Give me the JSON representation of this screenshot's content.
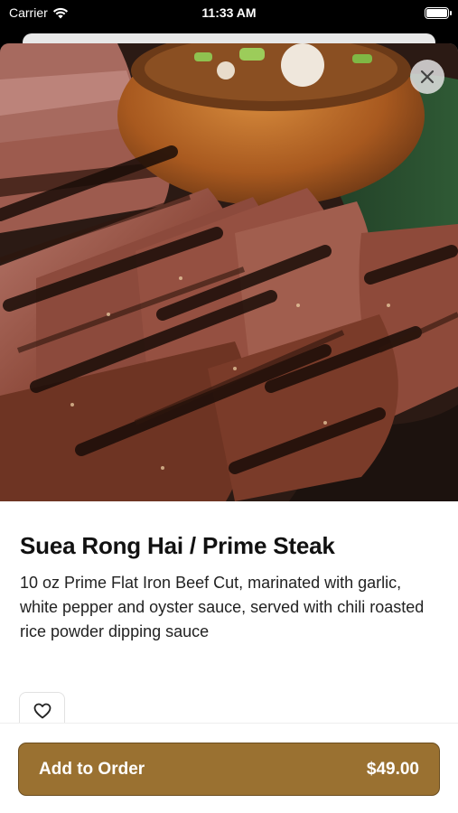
{
  "status_bar": {
    "carrier": "Carrier",
    "time": "11:33 AM"
  },
  "item": {
    "title": "Suea Rong Hai /  Prime Steak",
    "description": "10 oz Prime Flat Iron Beef Cut, marinated with garlic, white pepper and oyster sauce, served with chili roasted rice powder dipping sauce",
    "image_icon": "steak-photo"
  },
  "actions": {
    "close_icon": "close-icon",
    "favorite_icon": "heart-icon",
    "add_label": "Add to Order",
    "price": "$49.00"
  },
  "colors": {
    "accent": "#9a7131",
    "accent_border": "#6b4d1f"
  }
}
